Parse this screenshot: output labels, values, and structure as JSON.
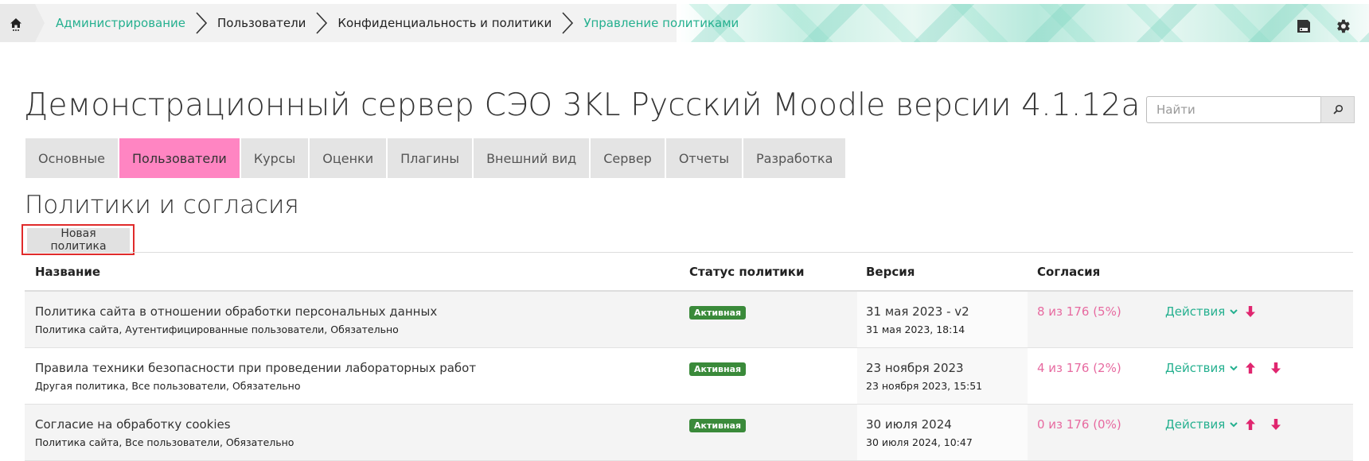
{
  "breadcrumb": {
    "items": [
      {
        "label": "Администрирование",
        "link": true
      },
      {
        "label": "Пользователи",
        "link": false
      },
      {
        "label": "Конфиденциальность и политики",
        "link": false
      },
      {
        "label": "Управление политиками",
        "link": true
      }
    ]
  },
  "icons": {
    "home": "home-icon",
    "save": "save-icon",
    "settings": "gear-icon",
    "search": "search-icon",
    "dropdown": "chevron-down-icon",
    "move_up": "arrow-up-icon",
    "move_down": "arrow-down-icon"
  },
  "header": {
    "site_title": "Демонстрационный сервер СЭО 3KL Русский Moodle версии 4.1.12а",
    "search_placeholder": "Найти"
  },
  "tabs": [
    {
      "label": "Основные",
      "active": false
    },
    {
      "label": "Пользователи",
      "active": true
    },
    {
      "label": "Курсы",
      "active": false
    },
    {
      "label": "Оценки",
      "active": false
    },
    {
      "label": "Плагины",
      "active": false
    },
    {
      "label": "Внешний вид",
      "active": false
    },
    {
      "label": "Сервер",
      "active": false
    },
    {
      "label": "Отчеты",
      "active": false
    },
    {
      "label": "Разработка",
      "active": false
    }
  ],
  "section": {
    "title": "Политики и согласия",
    "new_policy_label": "Новая политика"
  },
  "table": {
    "headers": {
      "name": "Название",
      "status": "Статус политики",
      "version": "Версия",
      "agreements": "Согласия"
    },
    "rows": [
      {
        "name": "Политика сайта в отношении обработки персональных данных",
        "details": "Политика сайта, Аутентифицированные пользователи, Обязательно",
        "status": "Активная",
        "version": "31 мая 2023 - v2",
        "version_date": "31 мая 2023, 18:14",
        "agreements": "8 из 176 (5%)",
        "actions": "Действия",
        "move_up": false,
        "move_down": true
      },
      {
        "name": "Правила техники безопасности при проведении лабораторных работ",
        "details": "Другая политика, Все пользователи, Обязательно",
        "status": "Активная",
        "version": "23 ноября 2023",
        "version_date": "23 ноября 2023, 15:51",
        "agreements": "4 из 176 (2%)",
        "actions": "Действия",
        "move_up": true,
        "move_down": true
      },
      {
        "name": "Согласие на обработку cookies",
        "details": "Политика сайта, Все пользователи, Обязательно",
        "status": "Активная",
        "version": "30 июля 2024",
        "version_date": "30 июля 2024, 10:47",
        "agreements": "0 из 176 (0%)",
        "actions": "Действия",
        "move_up": true,
        "move_down": true
      }
    ]
  },
  "colors": {
    "accent_link": "#25b08f",
    "active_tab": "#ff85c2",
    "status_active": "#3a8a3a",
    "agreements": "#e76aa0",
    "arrows": "#e0266f",
    "highlight_frame": "#e02b2b"
  }
}
